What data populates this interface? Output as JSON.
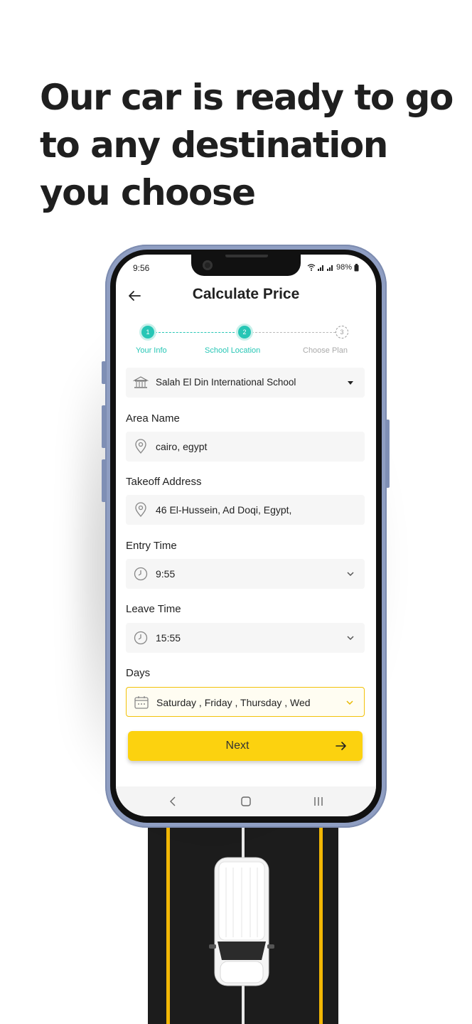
{
  "headline": [
    "Our car is ready to go",
    "to any destination",
    "you choose"
  ],
  "status_bar": {
    "time": "9:56",
    "battery": "98%"
  },
  "header": {
    "title": "Calculate Price"
  },
  "stepper": {
    "steps": [
      {
        "number": "1",
        "label": "Your Info",
        "state": "done"
      },
      {
        "number": "2",
        "label": "School Location",
        "state": "active"
      },
      {
        "number": "3",
        "label": "Choose Plan",
        "state": "pending"
      }
    ]
  },
  "form": {
    "school": {
      "value": "Salah El Din International School",
      "icon": "school-building-icon"
    },
    "area": {
      "label": "Area Name",
      "value": "cairo, egypt",
      "icon": "location-pin-icon"
    },
    "takeoff": {
      "label": "Takeoff Address",
      "value": "46 El-Hussein, Ad Doqi, Egypt,",
      "icon": "location-pin-icon"
    },
    "entry_time": {
      "label": "Entry Time",
      "value": "9:55",
      "icon": "clock-icon"
    },
    "leave_time": {
      "label": "Leave Time",
      "value": "15:55",
      "icon": "clock-icon"
    },
    "days": {
      "label": "Days",
      "value": "Saturday , Friday , Thursday , Wed",
      "icon": "calendar-icon"
    }
  },
  "next_button": {
    "label": "Next"
  },
  "colors": {
    "accent_teal": "#26c6b5",
    "accent_yellow": "#fcd20f",
    "phone_frame": "#8f9ec2"
  }
}
